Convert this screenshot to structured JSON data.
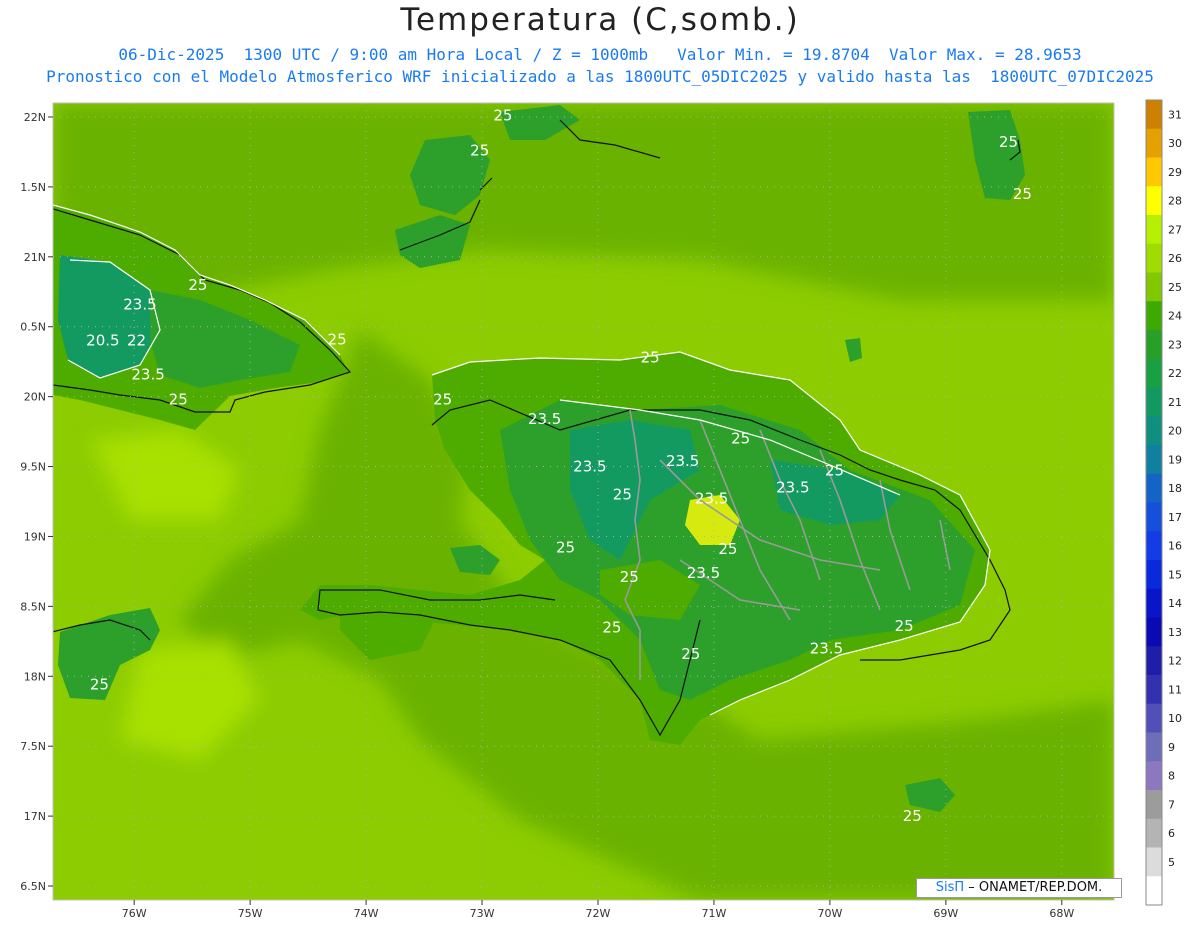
{
  "header": {
    "title": "Temperatura (C,somb.)",
    "line1": "06-Dic-2025  1300 UTC / 9:00 am Hora Local / Z = 1000mb   Valor Min. = 19.8704  Valor Max. = 28.9653",
    "line2": "Pronostico con el Modelo Atmosferico WRF inicializado a las 1800UTC_05DIC2025 y valido hasta las  1800UTC_07DIC2025"
  },
  "map": {
    "lon_range": [
      -76.7,
      -67.55
    ],
    "lat_range": [
      16.4,
      22.1
    ],
    "lon_ticks": [
      {
        "value": -76,
        "label": "76W"
      },
      {
        "value": -75,
        "label": "75W"
      },
      {
        "value": -74,
        "label": "74W"
      },
      {
        "value": -73,
        "label": "73W"
      },
      {
        "value": -72,
        "label": "72W"
      },
      {
        "value": -71,
        "label": "71W"
      },
      {
        "value": -70,
        "label": "70W"
      },
      {
        "value": -69,
        "label": "69W"
      },
      {
        "value": -68,
        "label": "68W"
      }
    ],
    "lat_ticks": [
      {
        "value": 22,
        "label": "22N"
      },
      {
        "value": 21.5,
        "label": "1.5N"
      },
      {
        "value": 21,
        "label": "21N"
      },
      {
        "value": 20.5,
        "label": "0.5N"
      },
      {
        "value": 20,
        "label": "20N"
      },
      {
        "value": 19.5,
        "label": "9.5N"
      },
      {
        "value": 19,
        "label": "19N"
      },
      {
        "value": 18.5,
        "label": "8.5N"
      },
      {
        "value": 18,
        "label": "18N"
      },
      {
        "value": 17.5,
        "label": "7.5N"
      },
      {
        "value": 17,
        "label": "17N"
      },
      {
        "value": 16.5,
        "label": "6.5N"
      }
    ],
    "contour_labels": [
      {
        "text": "25",
        "lon": -72.82,
        "lat": 22.01
      },
      {
        "text": "25",
        "lon": -73.02,
        "lat": 21.76
      },
      {
        "text": "25",
        "lon": -68.46,
        "lat": 21.82
      },
      {
        "text": "25",
        "lon": -68.34,
        "lat": 21.45
      },
      {
        "text": "25",
        "lon": -75.45,
        "lat": 20.8
      },
      {
        "text": "23.5",
        "lon": -75.95,
        "lat": 20.66
      },
      {
        "text": "20.5",
        "lon": -76.27,
        "lat": 20.4
      },
      {
        "text": "22",
        "lon": -75.98,
        "lat": 20.4
      },
      {
        "text": "25",
        "lon": -74.25,
        "lat": 20.41
      },
      {
        "text": "23.5",
        "lon": -75.88,
        "lat": 20.16
      },
      {
        "text": "25",
        "lon": -75.62,
        "lat": 19.98
      },
      {
        "text": "25",
        "lon": -71.55,
        "lat": 20.28
      },
      {
        "text": "25",
        "lon": -73.34,
        "lat": 19.98
      },
      {
        "text": "23.5",
        "lon": -72.46,
        "lat": 19.84
      },
      {
        "text": "25",
        "lon": -70.77,
        "lat": 19.7
      },
      {
        "text": "23.5",
        "lon": -72.07,
        "lat": 19.5
      },
      {
        "text": "23.5",
        "lon": -71.27,
        "lat": 19.54
      },
      {
        "text": "25",
        "lon": -69.96,
        "lat": 19.47
      },
      {
        "text": "23.5",
        "lon": -70.32,
        "lat": 19.35
      },
      {
        "text": "23.5",
        "lon": -71.02,
        "lat": 19.27
      },
      {
        "text": "25",
        "lon": -71.79,
        "lat": 19.3
      },
      {
        "text": "25",
        "lon": -70.88,
        "lat": 18.91
      },
      {
        "text": "25",
        "lon": -72.28,
        "lat": 18.92
      },
      {
        "text": "23.5",
        "lon": -71.09,
        "lat": 18.74
      },
      {
        "text": "25",
        "lon": -71.73,
        "lat": 18.71
      },
      {
        "text": "25",
        "lon": -69.36,
        "lat": 18.36
      },
      {
        "text": "25",
        "lon": -71.88,
        "lat": 18.35
      },
      {
        "text": "25",
        "lon": -71.2,
        "lat": 18.16
      },
      {
        "text": "23.5",
        "lon": -70.03,
        "lat": 18.2
      },
      {
        "text": "25",
        "lon": -76.3,
        "lat": 17.94
      },
      {
        "text": "25",
        "lon": -69.29,
        "lat": 17.0
      }
    ],
    "colors": {
      "ocean_warm": "#8ccc00",
      "ocean_hot": "#a8e000",
      "ocean_mid": "#6ab200",
      "land_mid": "#4eac00",
      "land_cool": "#2ca02a",
      "land_cold": "#139a61",
      "peak": "#d6ea10",
      "coast": "#111111",
      "border": "#9a9a9a",
      "contour": "#ffffff",
      "gridline": "#b0b0b0"
    }
  },
  "colorbar": {
    "labels": [
      "31",
      "30",
      "29",
      "28",
      "27",
      "26",
      "25",
      "24",
      "23",
      "22",
      "21",
      "20",
      "19",
      "18",
      "17",
      "16",
      "15",
      "14",
      "13",
      "12",
      "11",
      "10",
      "9",
      "8",
      "7",
      "6",
      "5"
    ],
    "colors": [
      "#cc8200",
      "#e6a000",
      "#ffc800",
      "#ffff00",
      "#b4f000",
      "#a0dc00",
      "#82c800",
      "#3caa00",
      "#28a028",
      "#18a042",
      "#109a62",
      "#0e9080",
      "#0f80a0",
      "#1464c8",
      "#1450dc",
      "#143ce6",
      "#0a28dc",
      "#0a14c8",
      "#0a0ab4",
      "#1e1ea8",
      "#3232b0",
      "#5050b8",
      "#6e6eb8",
      "#8c78be",
      "#9c9c9c",
      "#b4b4b4",
      "#dcdcdc",
      "#ffffff"
    ]
  },
  "credit": {
    "brand": "SisΠ",
    "text": " – ONAMET/REP.DOM."
  }
}
